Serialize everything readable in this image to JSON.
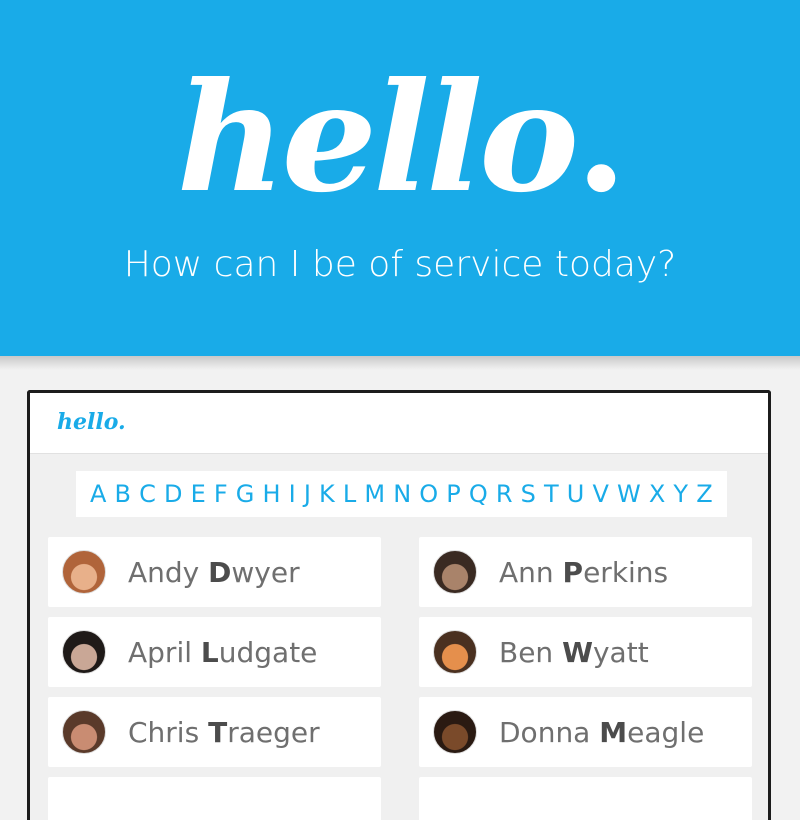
{
  "hero": {
    "logo": "hello",
    "logo_dot": ".",
    "tagline": "How can I be of service today?",
    "background_color": "#19abe8"
  },
  "app": {
    "logo": "hello."
  },
  "alphabet": [
    "A",
    "B",
    "C",
    "D",
    "E",
    "F",
    "G",
    "H",
    "I",
    "J",
    "K",
    "L",
    "M",
    "N",
    "O",
    "P",
    "Q",
    "R",
    "S",
    "T",
    "U",
    "V",
    "W",
    "X",
    "Y",
    "Z"
  ],
  "contacts": [
    {
      "first": "Andy",
      "last_initial": "D",
      "last_rest": "wyer",
      "avatar_color": "#b0643a",
      "avatar_bg": "#e8b08a"
    },
    {
      "first": "Ann",
      "last_initial": "P",
      "last_rest": "erkins",
      "avatar_color": "#3a2a22",
      "avatar_bg": "#a9836a"
    },
    {
      "first": "April",
      "last_initial": "L",
      "last_rest": "udgate",
      "avatar_color": "#1f1a18",
      "avatar_bg": "#c9a796"
    },
    {
      "first": "Ben",
      "last_initial": "W",
      "last_rest": "yatt",
      "avatar_color": "#4a3020",
      "avatar_bg": "#e58f4c"
    },
    {
      "first": "Chris",
      "last_initial": "T",
      "last_rest": "raeger",
      "avatar_color": "#5a3a2a",
      "avatar_bg": "#c98c72"
    },
    {
      "first": "Donna",
      "last_initial": "M",
      "last_rest": "eagle",
      "avatar_color": "#2a1a12",
      "avatar_bg": "#7a4a2a"
    }
  ]
}
